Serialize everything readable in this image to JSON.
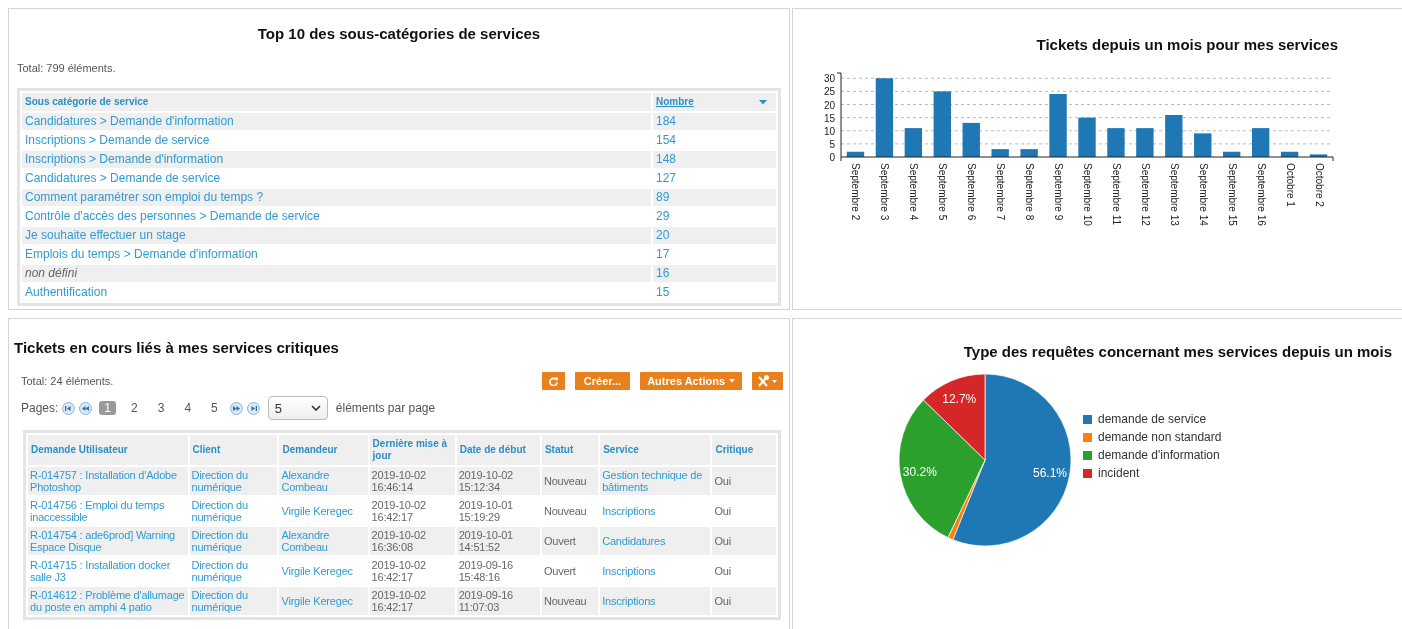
{
  "top_categories": {
    "title": "Top 10 des sous-catégories de services",
    "total": "Total: 799 éléments.",
    "columns": [
      {
        "label": "Sous catégorie de service",
        "sorted": false
      },
      {
        "label": "Nombre",
        "sorted": true
      }
    ],
    "rows": [
      {
        "category": "Candidatures > Demande d'information",
        "count": "184",
        "kind": "link"
      },
      {
        "category": "Inscriptions > Demande de service",
        "count": "154",
        "kind": "link"
      },
      {
        "category": "Inscriptions > Demande d'information",
        "count": "148",
        "kind": "link"
      },
      {
        "category": "Candidatures > Demande de service",
        "count": "127",
        "kind": "link"
      },
      {
        "category": "Comment paramétrer son emploi du temps ?",
        "count": "89",
        "kind": "link"
      },
      {
        "category": "Contrôle d'accès des personnes > Demande de service",
        "count": "29",
        "kind": "link"
      },
      {
        "category": "Je souhaite effectuer un stage",
        "count": "20",
        "kind": "link"
      },
      {
        "category": "Emplois du temps > Demande d'information",
        "count": "17",
        "kind": "link"
      },
      {
        "category": "non défini",
        "count": "16",
        "kind": "undefined"
      },
      {
        "category": "Authentification",
        "count": "15",
        "kind": "link"
      }
    ]
  },
  "tickets_chart": {
    "chart_data": {
      "type": "bar",
      "title": "Tickets depuis un mois pour mes services",
      "categories": [
        "Septembre 2",
        "Septembre 3",
        "Septembre 4",
        "Septembre 5",
        "Septembre 6",
        "Septembre 7",
        "Septembre 8",
        "Septembre 9",
        "Septembre 10",
        "Septembre 11",
        "Septembre 12",
        "Septembre 13",
        "Septembre 14",
        "Septembre 15",
        "Septembre 16",
        "Octobre 1",
        "Octobre 2"
      ],
      "grid": true,
      "series": [
        {
          "color": "#1f77b4",
          "values": [
            2,
            30,
            11,
            25,
            13,
            3,
            3,
            24,
            15,
            11,
            11,
            16,
            9,
            2,
            11,
            2,
            1
          ]
        }
      ],
      "ylim": [
        0,
        32
      ],
      "yticks": [
        0,
        5,
        10,
        15,
        20,
        25,
        30
      ]
    }
  },
  "critical_tickets": {
    "title": "Tickets en cours liés à mes services critiques",
    "total": "Total: 24 éléments.",
    "actions": [
      {
        "kind": "refresh"
      },
      {
        "kind": "text",
        "label": "Créer..."
      },
      {
        "kind": "dropdown",
        "label": "Autres Actions"
      },
      {
        "kind": "tools"
      }
    ],
    "pagination": {
      "label": "Pages:",
      "pages": [
        {
          "label": "1",
          "selected": true
        },
        {
          "label": "2",
          "selected": false
        },
        {
          "label": "3",
          "selected": false
        },
        {
          "label": "4",
          "selected": false
        },
        {
          "label": "5",
          "selected": false
        }
      ],
      "page_size": "5",
      "page_size_label": "éléments par page"
    },
    "columns": [
      {
        "label": "Demande Utilisateur",
        "link": true
      },
      {
        "label": "Client",
        "link": true
      },
      {
        "label": "Demandeur",
        "link": true
      },
      {
        "label": "Dernière mise à jour",
        "link": false
      },
      {
        "label": "Date de début",
        "link": false
      },
      {
        "label": "Statut",
        "link": false
      },
      {
        "label": "Service",
        "link": true
      },
      {
        "label": "Critique",
        "link": false
      }
    ],
    "rows": [
      [
        "R-014757 : Installation d'Adobe Photoshop",
        "Direction du numérique",
        "Alexandre Combeau",
        "2019-10-02 16:46:14",
        "2019-10-02 15:12:34",
        "Nouveau",
        "Gestion technique de bâtiments",
        "Oui"
      ],
      [
        "R-014756 : Emploi du temps inaccessible",
        "Direction du numérique",
        "Virgile Keregec",
        "2019-10-02 16:42:17",
        "2019-10-01 15:19:29",
        "Nouveau",
        "Inscriptions",
        "Oui"
      ],
      [
        "R-014754 : ade6prod] Warning Espace Disque",
        "Direction du numérique",
        "Alexandre Combeau",
        "2019-10-02 16:36:08",
        "2019-10-01 14:51:52",
        "Ouvert",
        "Candidatures",
        "Oui"
      ],
      [
        "R-014715 : Installation docker salle J3",
        "Direction du numérique",
        "Virgile Keregec",
        "2019-10-02 16:42:17",
        "2019-09-16 15:48:16",
        "Ouvert",
        "Inscriptions",
        "Oui"
      ],
      [
        "R-014612 : Problème d'allumage du poste en amphi 4 patio",
        "Direction du numérique",
        "Virgile Keregec",
        "2019-10-02 16:42:17",
        "2019-09-16 11:07:03",
        "Nouveau",
        "Inscriptions",
        "Oui"
      ]
    ]
  },
  "request_types": {
    "chart_data": {
      "type": "pie",
      "title": "Type des requêtes concernant mes services depuis un mois",
      "categories": [
        "demande de service",
        "demande non standard",
        "demande d'information",
        "incident"
      ],
      "values": [
        56.1,
        1.0,
        30.2,
        12.7
      ],
      "value_labels": [
        "56.1%",
        null,
        "30.2%",
        "12.7%"
      ]
    },
    "legend": [
      {
        "color": "#1f77b4"
      },
      {
        "color": "#ff7f0e"
      },
      {
        "color": "#2ca02c"
      },
      {
        "color": "#d62728"
      }
    ]
  }
}
